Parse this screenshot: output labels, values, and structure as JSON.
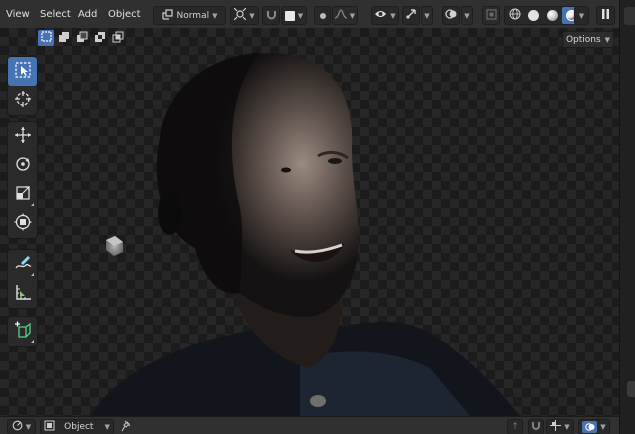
{
  "header": {
    "menu": [
      "View",
      "Select",
      "Add",
      "Object"
    ],
    "transform_orientation": "Normal",
    "shading_modes": [
      "wireframe",
      "solid",
      "material-preview",
      "rendered"
    ],
    "active_shading": "rendered"
  },
  "viewport": {
    "options_label": "Options",
    "select_modes": [
      "set",
      "extend",
      "subtract",
      "difference",
      "intersect"
    ]
  },
  "toolbar": {
    "tools": [
      "select-box",
      "cursor",
      "move",
      "rotate",
      "scale",
      "transform",
      "annotate",
      "measure",
      "add-cube"
    ],
    "active_tool": "select-box"
  },
  "bottombar": {
    "editor_type": "3D Viewport",
    "mode_label": "Object"
  },
  "colors": {
    "accent": "#4772b3",
    "header_bg": "#303030",
    "button_bg": "#282828",
    "toolbar_bg": "#2a2a2a",
    "text": "#e0e0e0"
  }
}
